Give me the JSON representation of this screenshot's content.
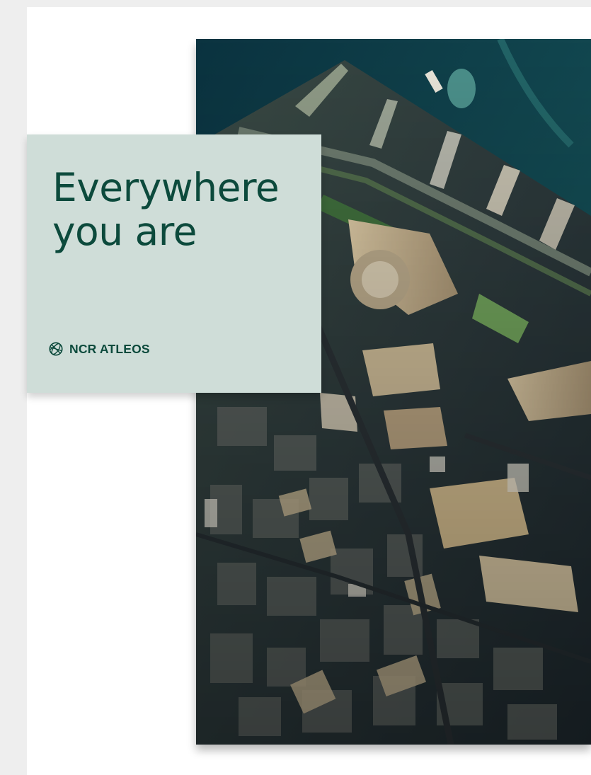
{
  "cover": {
    "headline_line1": "Everywhere",
    "headline_line2": "you are",
    "brand_name": "NCR ATLEOS"
  },
  "colors": {
    "page_background": "#eeeeee",
    "card_background": "#cfddd8",
    "brand_green": "#0c4a3c",
    "water": "#0f3c47"
  },
  "icons": {
    "brand_logo": "globe-icon"
  },
  "image": {
    "subject": "aerial-city-waterfront-photo"
  }
}
